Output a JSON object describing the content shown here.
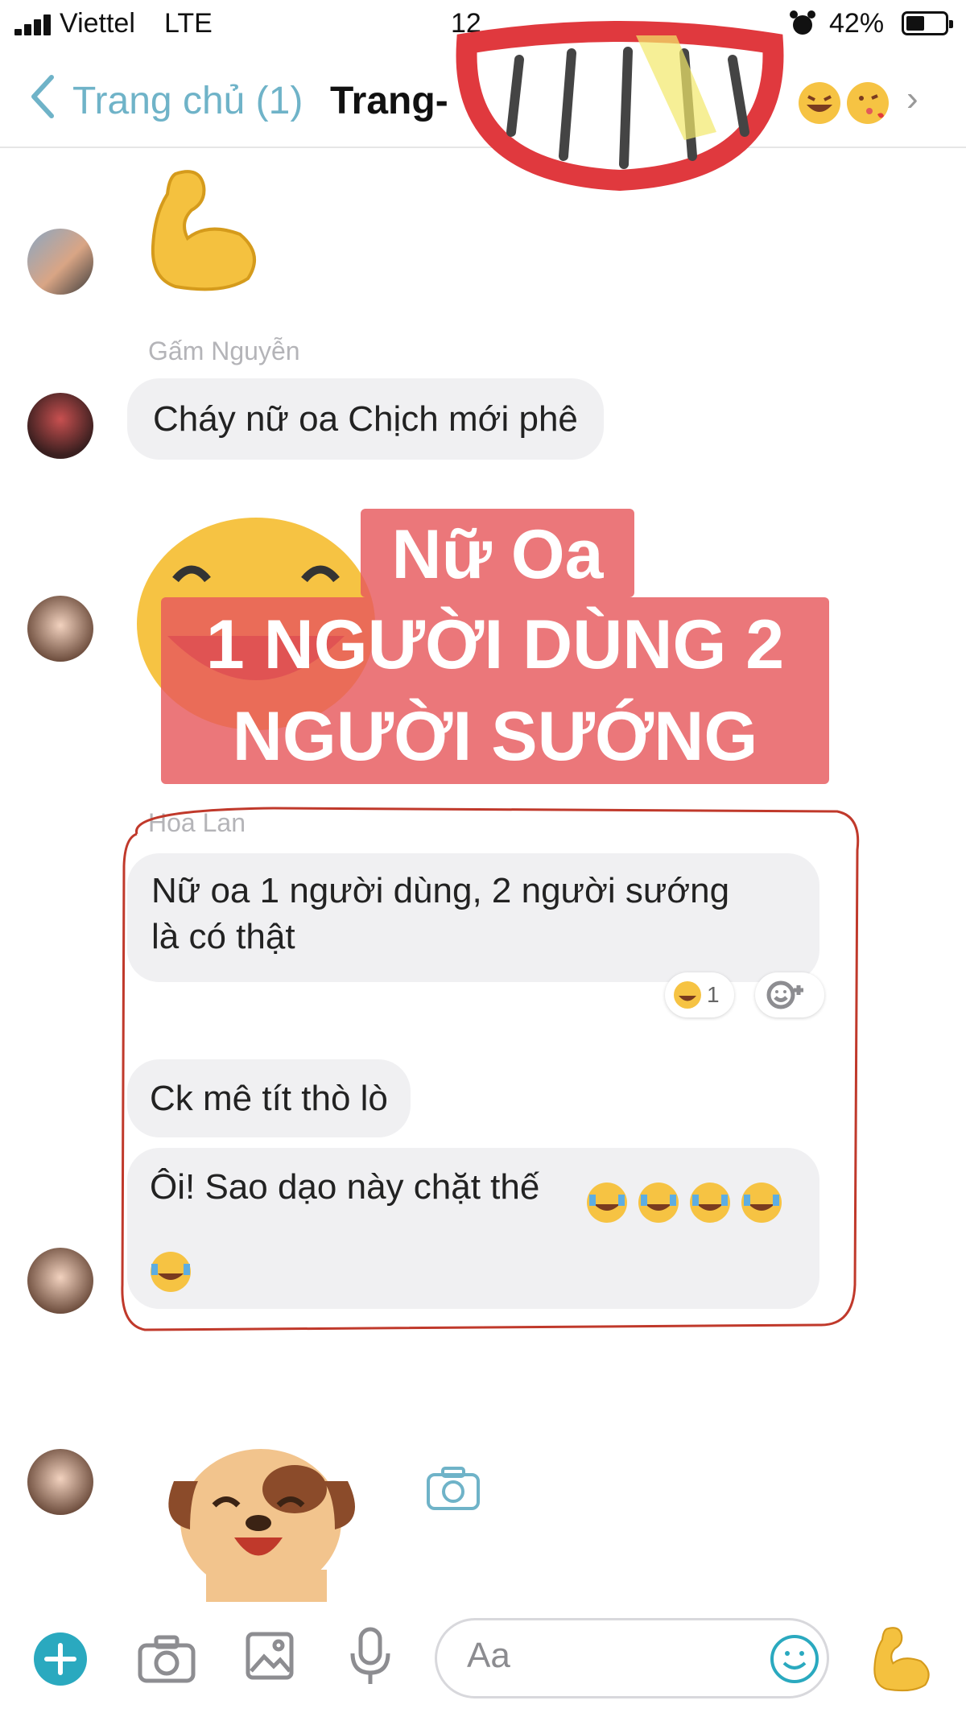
{
  "status": {
    "carrier": "Viettel",
    "network": "LTE",
    "time": "12",
    "battery": "42%"
  },
  "nav": {
    "back_label": "Trang chủ (1)",
    "title": "Trang-"
  },
  "messages": {
    "sender_gam": "Gấm Nguyễn",
    "gam_text": "Cháy nữ oa  Chịch mới phê",
    "sender_hoa": "Hoa Lan",
    "hoa_line1": "Nữ  oa 1 người  dùng, 2 người  sướng",
    "hoa_line2": "là có thật",
    "reaction_count": "1",
    "ck_text": "Ck mê tít  thò lò",
    "oi_text": "Ôi! Sao dạo này chặt thế"
  },
  "overlay": {
    "line1": "Nữ Oa",
    "line2": "1 NGƯỜI DÙNG 2",
    "line3": "NGƯỜI SƯỚNG",
    "box_color": "#e6595d"
  },
  "composer": {
    "placeholder": "Aa"
  },
  "colors": {
    "accent": "#6fb3c8",
    "bubble": "#f0f0f2",
    "circle_outline": "#c0392b"
  },
  "icons": [
    "signal-icon",
    "alarm-icon",
    "battery-icon",
    "back-chevron-icon",
    "laugh-emoji-icon",
    "kiss-emoji-icon",
    "chevron-right-icon",
    "flexed-biceps-emoji",
    "grin-emoji",
    "camera-icon",
    "plus-icon",
    "image-icon",
    "microphone-icon",
    "smiley-icon",
    "dog-sticker",
    "smile-mouth-sticker"
  ]
}
